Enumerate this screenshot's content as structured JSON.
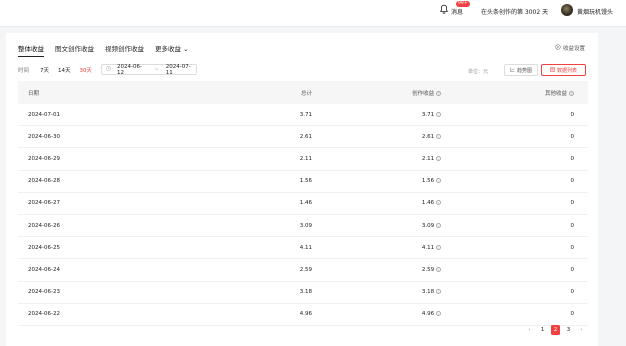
{
  "header": {
    "message_label": "消息",
    "message_badge": "99+",
    "days_text": "在头条创作的第 3002 天",
    "username": "黄烟玩机馒头"
  },
  "tabs": [
    {
      "label": "整体收益"
    },
    {
      "label": "图文创作收益"
    },
    {
      "label": "视频创作收益"
    },
    {
      "label": "更多收益"
    }
  ],
  "settings_label": "收益设置",
  "filters": {
    "time_label": "时间",
    "ranges": [
      "7天",
      "14天",
      "30天"
    ],
    "start_date": "2024-06-12",
    "end_date": "2024-07-11",
    "date_sep": "~",
    "unit": "单位：元",
    "trend_button": "趋势图",
    "list_button": "数据列表"
  },
  "table": {
    "headers": [
      "日期",
      "总计",
      "创作收益",
      "其他收益"
    ],
    "rows": [
      [
        "2024-07-01",
        "3.71",
        "3.71",
        "0"
      ],
      [
        "2024-06-30",
        "2.61",
        "2.61",
        "0"
      ],
      [
        "2024-06-29",
        "2.11",
        "2.11",
        "0"
      ],
      [
        "2024-06-28",
        "1.56",
        "1.56",
        "0"
      ],
      [
        "2024-06-27",
        "1.46",
        "1.46",
        "0"
      ],
      [
        "2024-06-26",
        "3.09",
        "3.09",
        "0"
      ],
      [
        "2024-06-25",
        "4.11",
        "4.11",
        "0"
      ],
      [
        "2024-06-24",
        "2.59",
        "2.59",
        "0"
      ],
      [
        "2024-06-23",
        "3.18",
        "3.18",
        "0"
      ],
      [
        "2024-06-22",
        "4.96",
        "4.96",
        "0"
      ]
    ]
  },
  "pagination": {
    "prev": "‹",
    "pages": [
      "1",
      "2",
      "3"
    ],
    "current": "2",
    "next": "›"
  },
  "colors": {
    "accent": "#f04142"
  }
}
